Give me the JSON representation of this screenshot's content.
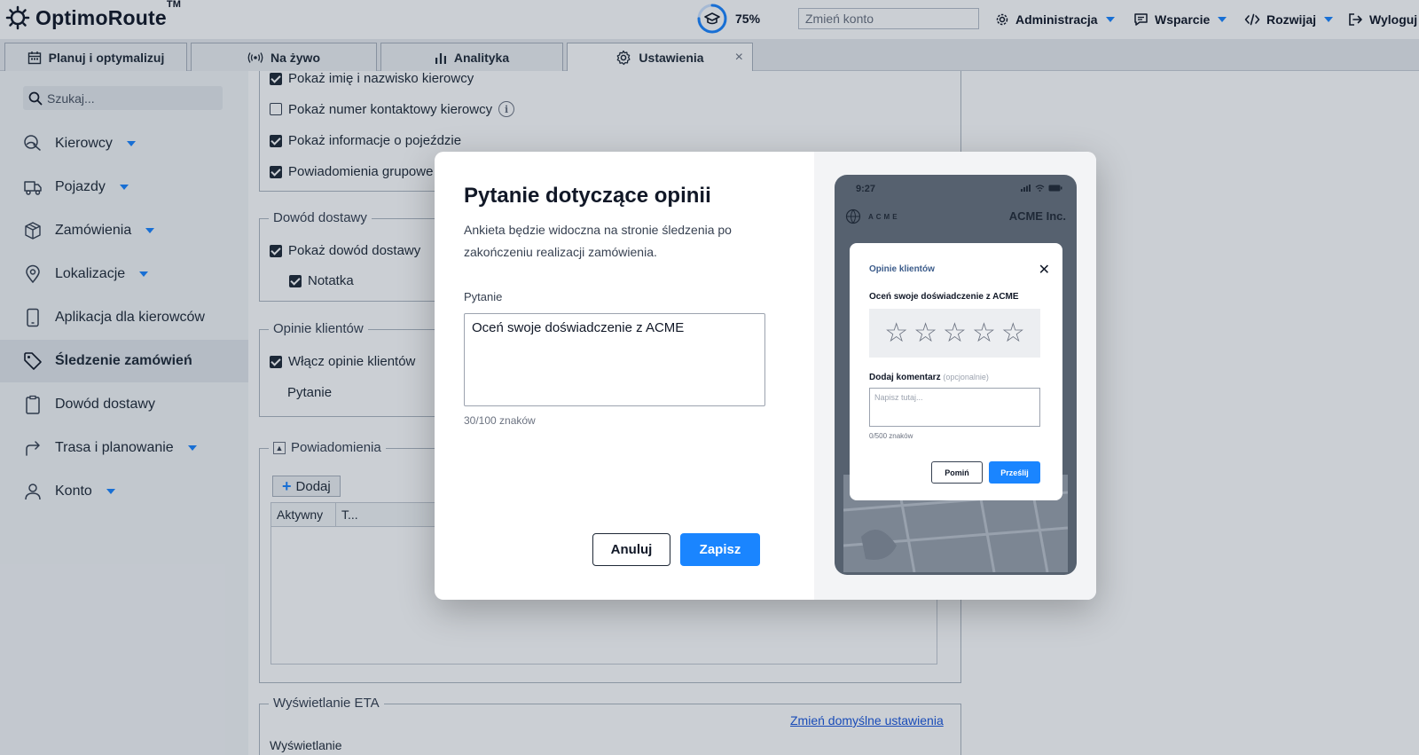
{
  "header": {
    "logo_text": "OptimoRoute",
    "logo_tm": "TM",
    "progress_value": 75,
    "progress_label": "75%",
    "account_placeholder": "Zmień konto",
    "nav": [
      {
        "label": "Administracja",
        "icon": "gear-icon"
      },
      {
        "label": "Wsparcie",
        "icon": "chat-icon"
      },
      {
        "label": "Rozwijaj",
        "icon": "code-icon"
      },
      {
        "label": "Wyloguj",
        "icon": "logout-icon"
      }
    ]
  },
  "tabs": [
    {
      "label": "Planuj i optymalizuj",
      "icon": "calendar-icon"
    },
    {
      "label": "Na żywo",
      "icon": "broadcast-icon"
    },
    {
      "label": "Analityka",
      "icon": "bar-chart-icon"
    },
    {
      "label": "Ustawienia",
      "icon": "gear-icon",
      "active": true
    }
  ],
  "tab_close": "×",
  "sidebar": {
    "search_placeholder": "Szukaj...",
    "items": [
      {
        "label": "Kierowcy",
        "dropdown": true
      },
      {
        "label": "Pojazdy",
        "dropdown": true
      },
      {
        "label": "Zamówienia",
        "dropdown": true
      },
      {
        "label": "Lokalizacje",
        "dropdown": true
      },
      {
        "label": "Aplikacja dla kierowców",
        "dropdown": false
      },
      {
        "label": "Śledzenie zamówień",
        "dropdown": false,
        "active": true
      },
      {
        "label": "Dowód dostawy",
        "dropdown": false
      },
      {
        "label": "Trasa i planowanie",
        "dropdown": true
      },
      {
        "label": "Konto",
        "dropdown": true
      }
    ]
  },
  "content": {
    "driver_opts": [
      {
        "label": "Pokaż imię i nazwisko kierowcy",
        "checked": true
      },
      {
        "label": "Pokaż numer kontaktowy kierowcy",
        "checked": false
      },
      {
        "label": "Pokaż informacje o pojeździe",
        "checked": true
      },
      {
        "label": "Powiadomienia grupowe",
        "checked": true
      }
    ],
    "pod_legend": "Dowód dostawy",
    "pod_opts": [
      {
        "label": "Pokaż dowód dostawy",
        "checked": true
      },
      {
        "label": "Notatka",
        "checked": true
      }
    ],
    "feedback_legend": "Opinie klientów",
    "feedback_enable": "Włącz opinie klientów",
    "feedback_question_label": "Pytanie",
    "notifications_legend": "Powiadomienia",
    "add_label": "Dodaj",
    "grid_cols": [
      "Aktywny",
      "T..."
    ],
    "eta_legend": "Wyświetlanie ETA",
    "eta_link": "Zmień domyślne ustawienia",
    "eta_label": "Wyświetlanie"
  },
  "modal": {
    "title": "Pytanie dotyczące opinii",
    "description": "Ankieta będzie widoczna na stronie śledzenia po zakończeniu realizacji zamówienia.",
    "question_label": "Pytanie",
    "question_value": "Oceń swoje doświadczenie z ACME",
    "char_count": "30/100 znaków",
    "cancel_label": "Anuluj",
    "save_label": "Zapisz"
  },
  "preview": {
    "time": "9:27",
    "acme_logo": "ACME",
    "brand": "ACME Inc.",
    "card_title": "Opinie klientów",
    "close_glyph": "✕",
    "question": "Oceń swoje doświadczenie z ACME",
    "stars": 5,
    "star_glyph": "☆",
    "comment_label": "Dodaj komentarz",
    "comment_optional": "(opcjonalnie)",
    "comment_placeholder": "Napisz tutaj...",
    "comment_count": "0/500 znaków",
    "skip_label": "Pomiń",
    "send_label": "Prześlij"
  }
}
